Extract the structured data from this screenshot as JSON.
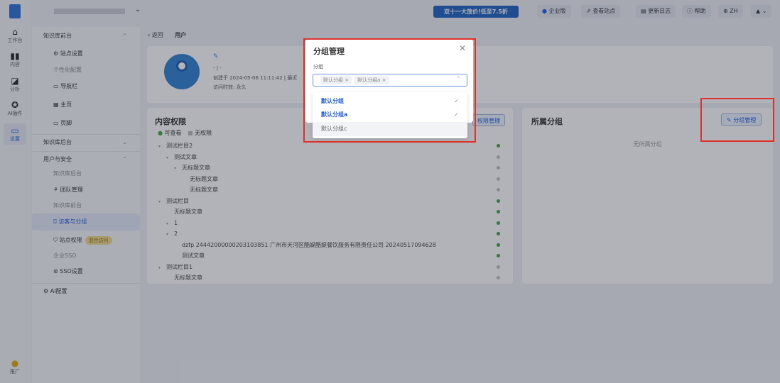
{
  "rail": [
    {
      "label": "工作台",
      "icon": "home-icon"
    },
    {
      "label": "内容",
      "icon": "book-icon"
    },
    {
      "label": "分析",
      "icon": "chart-icon"
    },
    {
      "label": "AI插件",
      "icon": "ai-plugin-icon"
    },
    {
      "label": "设置",
      "icon": "monitor-icon"
    },
    {
      "label": "推广",
      "icon": "coin-icon"
    }
  ],
  "topbar": {
    "promo": "双十一大放价!低至7.5折",
    "enterprise": "企业版",
    "view_site": "查看站点",
    "changelog": "更新日志",
    "help": "帮助",
    "lang": "ZH"
  },
  "nav": {
    "frontend": "知识库前台",
    "site_settings": "站点设置",
    "personalize": "个性化配置",
    "navbar": "导航栏",
    "home": "主页",
    "footer": "页脚",
    "backend": "知识库后台",
    "user_security": "用户与安全",
    "kb_backend": "知识库后台",
    "team": "团队管理",
    "kb_frontend": "知识库前台",
    "visitors": "访客与分组",
    "site_perm": "站点权限",
    "mixed_badge": "混合访问",
    "sso": "企业SSO",
    "sso_settings": "SSO设置",
    "ai_config": "AI配置"
  },
  "breadcrumb": {
    "back": "返回",
    "title": "用户"
  },
  "profile": {
    "name": "- | -",
    "created": "创建于 2024-05-06 11:11:42 | 最近",
    "validity": "访问时效: 永久"
  },
  "content_perm": {
    "title": "内容权限",
    "legend_view": "可查看",
    "legend_none": "无权限",
    "manage": "权限管理",
    "colors": {
      "view": "#3aa63a",
      "none": "#c0c0c0"
    },
    "rows": [
      {
        "label": "测试栏目2",
        "depth": 0,
        "arrow": true,
        "viewable": true
      },
      {
        "label": "测试文章",
        "depth": 1,
        "arrow": true,
        "viewable": false
      },
      {
        "label": "无标题文章",
        "depth": 2,
        "arrow": true,
        "viewable": false
      },
      {
        "label": "无标题文章",
        "depth": 3,
        "arrow": false,
        "viewable": false
      },
      {
        "label": "无标题文章",
        "depth": 3,
        "arrow": false,
        "viewable": false
      },
      {
        "label": "测试栏目",
        "depth": 0,
        "arrow": true,
        "viewable": true
      },
      {
        "label": "无标题文章",
        "depth": 1,
        "arrow": false,
        "viewable": true
      },
      {
        "label": "1",
        "depth": 1,
        "arrow": true,
        "viewable": true
      },
      {
        "label": "2",
        "depth": 1,
        "arrow": true,
        "viewable": true
      },
      {
        "label": "dzfp 24442000000203103851 广州市天河区酷媞酷媞餐饮服务有限责任公司 20240517094628",
        "depth": 2,
        "arrow": false,
        "viewable": true
      },
      {
        "label": "测试文章",
        "depth": 2,
        "arrow": false,
        "viewable": true
      },
      {
        "label": "测试栏目1",
        "depth": 0,
        "arrow": true,
        "viewable": false
      },
      {
        "label": "无标题文章",
        "depth": 1,
        "arrow": false,
        "viewable": false
      }
    ]
  },
  "groups": {
    "title": "所属分组",
    "manage": "分组管理",
    "empty": "无所属分组"
  },
  "modal": {
    "title": "分组管理",
    "field_label": "分组",
    "tags": [
      "默认分组",
      "默认分组a"
    ],
    "options": [
      {
        "label": "默认分组",
        "selected": true
      },
      {
        "label": "默认分组a",
        "selected": true
      },
      {
        "label": "默认分组c",
        "selected": false
      }
    ]
  },
  "accent": "#1e5bd8"
}
